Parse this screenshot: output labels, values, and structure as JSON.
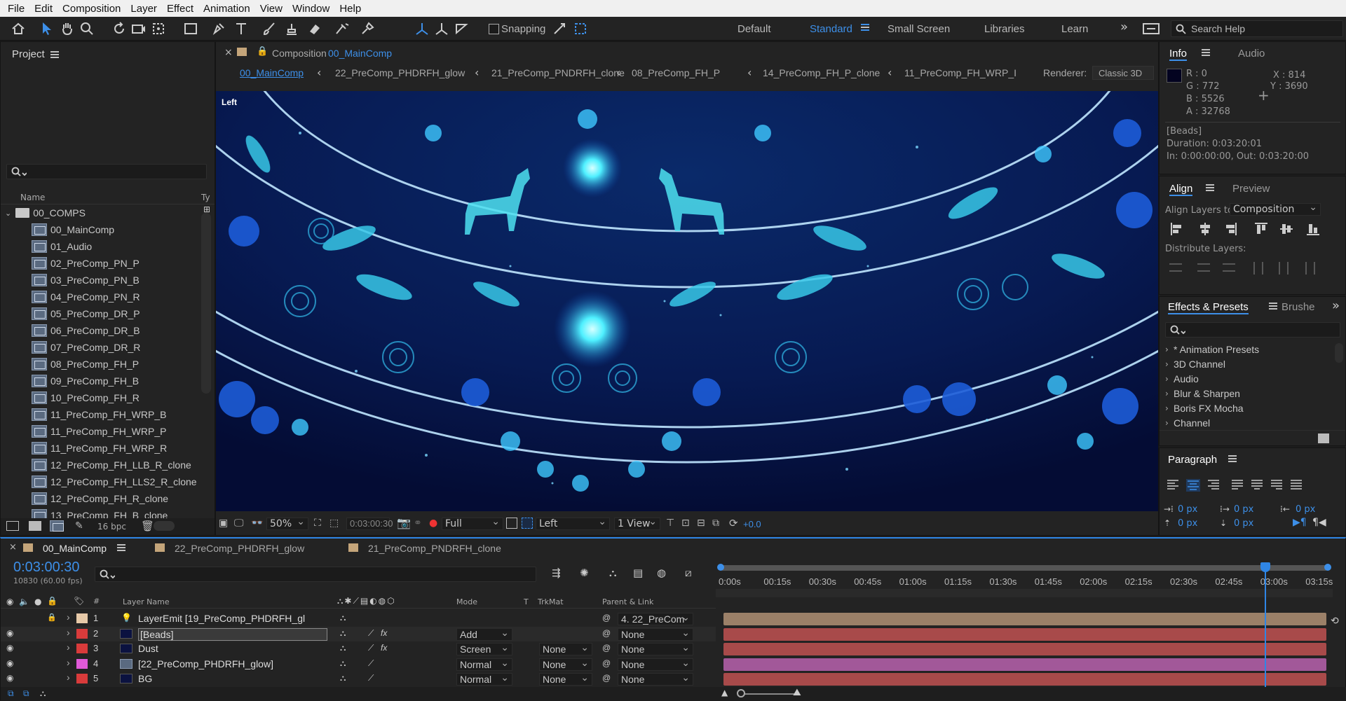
{
  "menu": [
    "File",
    "Edit",
    "Composition",
    "Layer",
    "Effect",
    "Animation",
    "View",
    "Window",
    "Help"
  ],
  "toolbar": {
    "snapping_label": "Snapping",
    "workspaces": [
      "Default",
      "Standard",
      "Small Screen",
      "Libraries",
      "Learn"
    ],
    "active_workspace": "Standard",
    "search_help": "Search Help"
  },
  "project": {
    "title": "Project",
    "col_name": "Name",
    "col_type": "Ty",
    "folder": "00_COMPS",
    "items": [
      "00_MainComp",
      "01_Audio",
      "02_PreComp_PN_P",
      "03_PreComp_PN_B",
      "04_PreComp_PN_R",
      "05_PreComp_DR_P",
      "06_PreComp_DR_B",
      "07_PreComp_DR_R",
      "08_PreComp_FH_P",
      "09_PreComp_FH_B",
      "10_PreComp_FH_R",
      "11_PreComp_FH_WRP_B",
      "11_PreComp_FH_WRP_P",
      "11_PreComp_FH_WRP_R",
      "12_PreComp_FH_LLB_R_clone",
      "12_PreComp_FH_LLS2_R_clone",
      "12_PreComp_FH_R_clone",
      "13_PreComp_FH_B_clone"
    ],
    "bpc": "16 bpc"
  },
  "composition": {
    "panel_prefix": "Composition",
    "panel_name": "00_MainComp",
    "breadcrumbs": [
      "00_MainComp",
      "22_PreComp_PHDRFH_glow",
      "21_PreComp_PNDRFH_clone",
      "08_PreComp_FH_P",
      "14_PreComp_FH_P_clone",
      "11_PreComp_FH_WRP_I"
    ],
    "renderer_label": "Renderer:",
    "renderer_value": "Classic 3D",
    "view_label": "Left",
    "zoom": "50%",
    "timecode": "0:03:00:30",
    "resolution": "Full",
    "camera": "Left",
    "views": "1 View",
    "exposure": "+0.0"
  },
  "info": {
    "tabs": [
      "Info",
      "Audio"
    ],
    "r": "R :  0",
    "g": "G :  772",
    "b": "B :  5526",
    "a": "A :  32768",
    "x": "X : 814",
    "y": "Y : 3690",
    "layer_name": "[Beads]",
    "duration": "Duration: 0:03:20:01",
    "inout": "In: 0:00:00:00, Out: 0:03:20:00"
  },
  "align": {
    "tabs": [
      "Align",
      "Preview"
    ],
    "align_to_label": "Align Layers to:",
    "align_to_value": "Composition",
    "distribute_label": "Distribute Layers:"
  },
  "effects": {
    "tabs": [
      "Effects & Presets",
      "Brushe"
    ],
    "items": [
      "* Animation Presets",
      "3D Channel",
      "Audio",
      "Blur & Sharpen",
      "Boris FX Mocha",
      "Channel"
    ]
  },
  "paragraph": {
    "title": "Paragraph",
    "values": [
      "0 px",
      "0 px",
      "0 px",
      "0 px",
      "0 px"
    ]
  },
  "timeline": {
    "tabs": [
      "00_MainComp",
      "22_PreComp_PHDRFH_glow",
      "21_PreComp_PNDRFH_clone"
    ],
    "timecode": "0:03:00:30",
    "frames": "10830 (60.00 fps)",
    "headers": {
      "layer_name": "Layer Name",
      "mode": "Mode",
      "t": "T",
      "trkmat": "TrkMat",
      "parent": "Parent & Link"
    },
    "ruler": [
      "0:00s",
      "00:15s",
      "00:30s",
      "00:45s",
      "01:00s",
      "01:15s",
      "01:30s",
      "01:45s",
      "02:00s",
      "02:15s",
      "02:30s",
      "02:45s",
      "03:00s",
      "03:15s"
    ],
    "layers": [
      {
        "num": "1",
        "name": "LayerEmit [19_PreComp_PHDRFH_gl",
        "mode": "",
        "trkmat": "",
        "parent": "4. 22_PreCom",
        "color": "#e6c9a8",
        "bar": "#9b8068"
      },
      {
        "num": "2",
        "name": "[Beads]",
        "mode": "Add",
        "trkmat": "",
        "parent": "None",
        "color": "#d93b3b",
        "bar": "#a84a4a"
      },
      {
        "num": "3",
        "name": "Dust",
        "mode": "Screen",
        "trkmat": "None",
        "parent": "None",
        "color": "#d93b3b",
        "bar": "#a84a4a"
      },
      {
        "num": "4",
        "name": "[22_PreComp_PHDRFH_glow]",
        "mode": "Normal",
        "trkmat": "None",
        "parent": "None",
        "color": "#e05ad8",
        "bar": "#a25899"
      },
      {
        "num": "5",
        "name": "BG",
        "mode": "Normal",
        "trkmat": "None",
        "parent": "None",
        "color": "#d93b3b",
        "bar": "#a84a4a"
      }
    ]
  },
  "colors": {
    "accent": "#3d8fe8",
    "playhead": "#2f86e6"
  }
}
